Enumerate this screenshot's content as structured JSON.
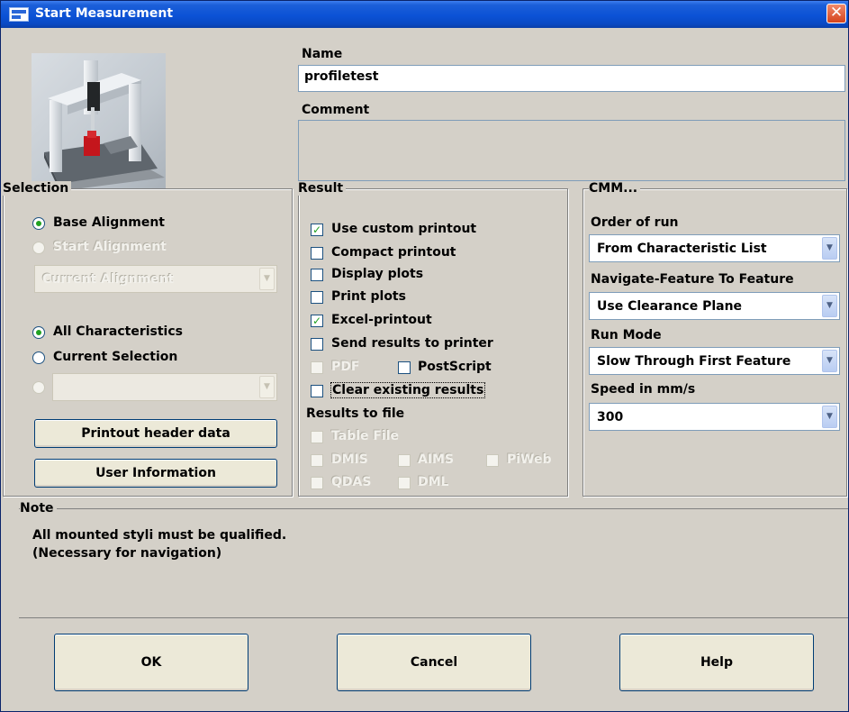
{
  "window": {
    "title": "Start Measurement",
    "close_glyph": "✕"
  },
  "name_field": {
    "label": "Name",
    "value": "profiletest"
  },
  "comment_field": {
    "label": "Comment",
    "value": ""
  },
  "selection": {
    "title": "Selection",
    "base_alignment": "Base Alignment",
    "start_alignment": "Start Alignment",
    "alignment_combo": "Current Alignment",
    "all_characteristics": "All Characteristics",
    "current_selection": "Current Selection",
    "selection_combo": "",
    "printout_header_button": "Printout header data",
    "user_information_button": "User Information"
  },
  "result": {
    "title": "Result",
    "use_custom_printout": "Use custom printout",
    "compact_printout": "Compact printout",
    "display_plots": "Display plots",
    "print_plots": "Print plots",
    "excel_printout": "Excel-printout",
    "send_results_to_printer": "Send results to printer",
    "pdf": "PDF",
    "postscript": "PostScript",
    "clear_existing_results": "Clear existing results",
    "results_to_file": "Results to file",
    "table_file": "Table File",
    "dmis": "DMIS",
    "aims": "AIMS",
    "piweb": "PiWeb",
    "qdas": "QDAS",
    "dml": "DML",
    "checked_glyph": "✓"
  },
  "cmm": {
    "title": "CMM...",
    "order_of_run_label": "Order of run",
    "order_of_run_value": "From Characteristic List",
    "navigate_label": "Navigate-Feature To Feature",
    "navigate_value": "Use Clearance Plane",
    "run_mode_label": "Run Mode",
    "run_mode_value": "Slow Through First Feature",
    "speed_label": "Speed in mm/s",
    "speed_value": "300",
    "dropdown_glyph": "▼"
  },
  "note": {
    "title": "Note",
    "line1": "All mounted styli must be qualified.",
    "line2": "(Necessary for navigation)"
  },
  "buttons": {
    "ok": "OK",
    "cancel": "Cancel",
    "help": "Help"
  }
}
